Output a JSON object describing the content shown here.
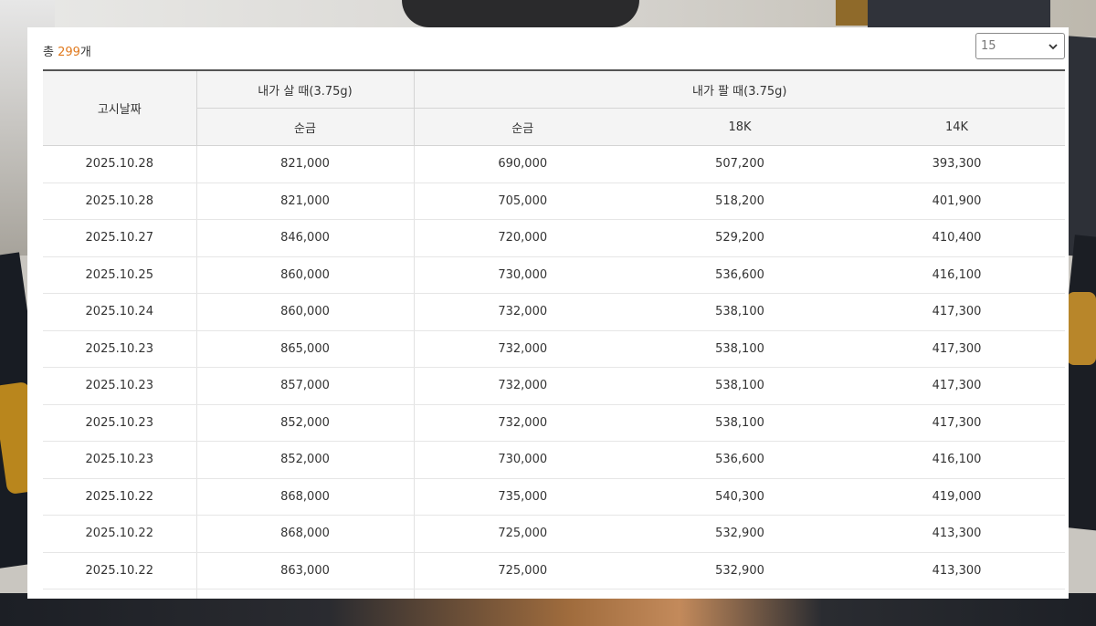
{
  "summary": {
    "prefix": "총 ",
    "count": "299",
    "suffix": "개"
  },
  "page_size": {
    "selected": "15"
  },
  "table": {
    "headers": {
      "date": "고시날짜",
      "buy_group": "내가 살 때(3.75g)",
      "sell_group": "내가 팔 때(3.75g)",
      "buy_pure": "순금",
      "sell_pure": "순금",
      "sell_18k": "18K",
      "sell_14k": "14K"
    },
    "rows": [
      [
        "2025.10.28",
        "821,000",
        "690,000",
        "507,200",
        "393,300"
      ],
      [
        "2025.10.28",
        "821,000",
        "705,000",
        "518,200",
        "401,900"
      ],
      [
        "2025.10.27",
        "846,000",
        "720,000",
        "529,200",
        "410,400"
      ],
      [
        "2025.10.25",
        "860,000",
        "730,000",
        "536,600",
        "416,100"
      ],
      [
        "2025.10.24",
        "860,000",
        "732,000",
        "538,100",
        "417,300"
      ],
      [
        "2025.10.23",
        "865,000",
        "732,000",
        "538,100",
        "417,300"
      ],
      [
        "2025.10.23",
        "857,000",
        "732,000",
        "538,100",
        "417,300"
      ],
      [
        "2025.10.23",
        "852,000",
        "732,000",
        "538,100",
        "417,300"
      ],
      [
        "2025.10.23",
        "852,000",
        "730,000",
        "536,600",
        "416,100"
      ],
      [
        "2025.10.22",
        "868,000",
        "735,000",
        "540,300",
        "419,000"
      ],
      [
        "2025.10.22",
        "868,000",
        "725,000",
        "532,900",
        "413,300"
      ],
      [
        "2025.10.22",
        "863,000",
        "725,000",
        "532,900",
        "413,300"
      ]
    ]
  },
  "colors": {
    "accent": "#e07a1f",
    "header_bg": "#f4f4f4"
  }
}
